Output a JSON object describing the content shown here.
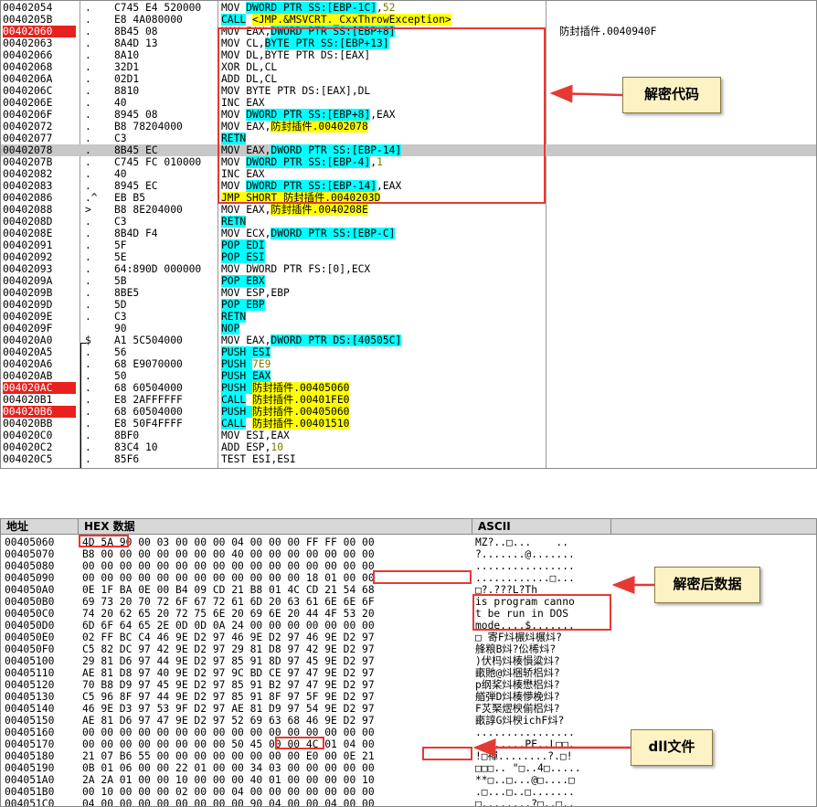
{
  "disasm": {
    "rows": [
      {
        "addr": "00402054",
        "mark": ".",
        "hex": "C745 E4 520000",
        "asm": [
          [
            "MOV ",
            ""
          ],
          [
            "DWORD PTR SS:[EBP-1C]",
            "c"
          ],
          [
            ",",
            ""
          ],
          [
            "52",
            "w"
          ]
        ]
      },
      {
        "addr": "0040205B",
        "mark": ".",
        "hex": "E8 4A080000",
        "asm": [
          [
            "CALL",
            "c"
          ],
          [
            " ",
            ""
          ],
          [
            "<JMP.&MSVCRT._CxxThrowException>",
            "y"
          ]
        ]
      },
      {
        "addr": "00402060",
        "mark": ".",
        "hex": "8B45 08",
        "hl": true,
        "asm": [
          [
            "MOV EAX,",
            ""
          ],
          [
            "DWORD PTR SS:[EBP+8]",
            "c"
          ]
        ],
        "comment": "防封插件.0040940F"
      },
      {
        "addr": "00402063",
        "mark": ".",
        "hex": "8A4D 13",
        "asm": [
          [
            "MOV CL,",
            ""
          ],
          [
            "BYTE PTR SS:[EBP+13]",
            "c"
          ]
        ]
      },
      {
        "addr": "00402066",
        "mark": ".",
        "hex": "8A10",
        "asm": [
          [
            "MOV DL,BYTE PTR DS:[EAX]",
            ""
          ]
        ]
      },
      {
        "addr": "00402068",
        "mark": ".",
        "hex": "32D1",
        "asm": [
          [
            "XOR DL,CL",
            ""
          ]
        ]
      },
      {
        "addr": "0040206A",
        "mark": ".",
        "hex": "02D1",
        "asm": [
          [
            "ADD DL,CL",
            ""
          ]
        ]
      },
      {
        "addr": "0040206C",
        "mark": ".",
        "hex": "8810",
        "asm": [
          [
            "MOV BYTE PTR DS:[EAX],DL",
            ""
          ]
        ]
      },
      {
        "addr": "0040206E",
        "mark": ".",
        "hex": "40",
        "asm": [
          [
            "INC EAX",
            ""
          ]
        ]
      },
      {
        "addr": "0040206F",
        "mark": ".",
        "hex": "8945 08",
        "asm": [
          [
            "MOV ",
            ""
          ],
          [
            "DWORD PTR SS:[EBP+8]",
            "c"
          ],
          [
            ",EAX",
            ""
          ]
        ]
      },
      {
        "addr": "00402072",
        "mark": ".",
        "hex": "B8 78204000",
        "asm": [
          [
            "MOV EAX,",
            ""
          ],
          [
            "防封插件.00402078",
            "y"
          ]
        ]
      },
      {
        "addr": "00402077",
        "mark": ".",
        "hex": "C3",
        "asm": [
          [
            "RETN",
            "c"
          ]
        ]
      },
      {
        "addr": "00402078",
        "mark": ".",
        "hex": "8B45 EC",
        "sel": true,
        "asm": [
          [
            "MOV EAX,",
            ""
          ],
          [
            "DWORD PTR SS:[EBP-14]",
            "c"
          ]
        ]
      },
      {
        "addr": "0040207B",
        "mark": ".",
        "hex": "C745 FC 010000",
        "asm": [
          [
            "MOV ",
            ""
          ],
          [
            "DWORD PTR SS:[EBP-4]",
            "c"
          ],
          [
            ",",
            ""
          ],
          [
            "1",
            "w"
          ]
        ]
      },
      {
        "addr": "00402082",
        "mark": ".",
        "hex": "40",
        "asm": [
          [
            "INC EAX",
            ""
          ]
        ]
      },
      {
        "addr": "00402083",
        "mark": ".",
        "hex": "8945 EC",
        "asm": [
          [
            "MOV ",
            ""
          ],
          [
            "DWORD PTR SS:[EBP-14]",
            "c"
          ],
          [
            ",EAX",
            ""
          ]
        ]
      },
      {
        "addr": "00402086",
        "mark": ".^",
        "hex": "EB B5",
        "asm": [
          [
            "JMP SHORT 防封插件.0040203D",
            "y"
          ]
        ]
      },
      {
        "addr": "00402088",
        "mark": ">",
        "hex": "B8 8E204000",
        "asm": [
          [
            "MOV EAX,",
            ""
          ],
          [
            "防封插件.0040208E",
            "y"
          ]
        ]
      },
      {
        "addr": "0040208D",
        "mark": ".",
        "hex": "C3",
        "asm": [
          [
            "RETN",
            "c"
          ]
        ]
      },
      {
        "addr": "0040208E",
        "mark": ".",
        "hex": "8B4D F4",
        "asm": [
          [
            "MOV ECX,",
            ""
          ],
          [
            "DWORD PTR SS:[EBP-C]",
            "c"
          ]
        ]
      },
      {
        "addr": "00402091",
        "mark": ".",
        "hex": "5F",
        "asm": [
          [
            "POP EDI",
            "c"
          ]
        ]
      },
      {
        "addr": "00402092",
        "mark": ".",
        "hex": "5E",
        "asm": [
          [
            "POP ESI",
            "c"
          ]
        ]
      },
      {
        "addr": "00402093",
        "mark": ".",
        "hex": "64:890D 000000",
        "asm": [
          [
            "MOV DWORD PTR FS:[0],ECX",
            ""
          ]
        ]
      },
      {
        "addr": "0040209A",
        "mark": ".",
        "hex": "5B",
        "asm": [
          [
            "POP EBX",
            "c"
          ]
        ]
      },
      {
        "addr": "0040209B",
        "mark": ".",
        "hex": "8BE5",
        "asm": [
          [
            "MOV ESP,EBP",
            ""
          ]
        ]
      },
      {
        "addr": "0040209D",
        "mark": ".",
        "hex": "5D",
        "asm": [
          [
            "POP EBP",
            "c"
          ]
        ]
      },
      {
        "addr": "0040209E",
        "mark": ".",
        "hex": "C3",
        "asm": [
          [
            "RETN",
            "c"
          ]
        ]
      },
      {
        "addr": "0040209F",
        "mark": "",
        "hex": "90",
        "asm": [
          [
            "NOP",
            "c"
          ]
        ]
      },
      {
        "addr": "004020A0",
        "mark": "$",
        "hex": "A1 5C504000",
        "asm": [
          [
            "MOV EAX,",
            ""
          ],
          [
            "DWORD PTR DS:[40505C]",
            "c"
          ]
        ]
      },
      {
        "addr": "004020A5",
        "mark": ".",
        "hex": "56",
        "asm": [
          [
            "PUSH ESI",
            "c"
          ]
        ]
      },
      {
        "addr": "004020A6",
        "mark": ".",
        "hex": "68 E9070000",
        "asm": [
          [
            "PUSH ",
            "c"
          ],
          [
            "7E9",
            "w"
          ]
        ]
      },
      {
        "addr": "004020AB",
        "mark": ".",
        "hex": "50",
        "asm": [
          [
            "PUSH EAX",
            "c"
          ]
        ]
      },
      {
        "addr": "004020AC",
        "mark": ".",
        "hex": "68 60504000",
        "hl": true,
        "asm": [
          [
            "PUSH ",
            "c"
          ],
          [
            "防封插件.00405060",
            "y"
          ]
        ]
      },
      {
        "addr": "004020B1",
        "mark": ".",
        "hex": "E8 2AFFFFFF",
        "asm": [
          [
            "CALL",
            "c"
          ],
          [
            " ",
            ""
          ],
          [
            "防封插件.00401FE0",
            "y"
          ]
        ]
      },
      {
        "addr": "004020B6",
        "mark": ".",
        "hex": "68 60504000",
        "hl": true,
        "asm": [
          [
            "PUSH ",
            "c"
          ],
          [
            "防封插件.00405060",
            "y"
          ]
        ]
      },
      {
        "addr": "004020BB",
        "mark": ".",
        "hex": "E8 50F4FFFF",
        "asm": [
          [
            "CALL",
            "c"
          ],
          [
            " ",
            ""
          ],
          [
            "防封插件.00401510",
            "y"
          ]
        ]
      },
      {
        "addr": "004020C0",
        "mark": ".",
        "hex": "8BF0",
        "asm": [
          [
            "MOV ESI,EAX",
            ""
          ]
        ]
      },
      {
        "addr": "004020C2",
        "mark": ".",
        "hex": "83C4 10",
        "asm": [
          [
            "ADD ESP,",
            ""
          ],
          [
            "10",
            "w"
          ]
        ]
      },
      {
        "addr": "004020C5",
        "mark": ".",
        "hex": "85F6",
        "asm": [
          [
            "TEST ESI,ESI",
            ""
          ]
        ]
      }
    ]
  },
  "dump": {
    "headers": {
      "addr": "地址",
      "hex": "HEX 数据",
      "ascii": "ASCII"
    },
    "rows": [
      {
        "addr": "00405060",
        "hex": "4D 5A 90 00 03 00 00 00 04 00 00 00 FF FF 00 00",
        "ascii": "MZ?..□...    .."
      },
      {
        "addr": "00405070",
        "hex": "B8 00 00 00 00 00 00 00 40 00 00 00 00 00 00 00",
        "ascii": "?.......@......."
      },
      {
        "addr": "00405080",
        "hex": "00 00 00 00 00 00 00 00 00 00 00 00 00 00 00 00",
        "ascii": "................"
      },
      {
        "addr": "00405090",
        "hex": "00 00 00 00 00 00 00 00 00 00 00 00 18 01 00 00",
        "ascii": "............□..."
      },
      {
        "addr": "004050A0",
        "hex": "0E 1F BA 0E 00 B4 09 CD 21 B8 01 4C CD 21 54 68",
        "ascii": "□?.???L?Th"
      },
      {
        "addr": "004050B0",
        "hex": "69 73 20 70 72 6F 67 72 61 6D 20 63 61 6E 6E 6F",
        "ascii": "is program canno"
      },
      {
        "addr": "004050C0",
        "hex": "74 20 62 65 20 72 75 6E 20 69 6E 20 44 4F 53 20",
        "ascii": "t be run in DOS "
      },
      {
        "addr": "004050D0",
        "hex": "6D 6F 64 65 2E 0D 0D 0A 24 00 00 00 00 00 00 00",
        "ascii": "mode....$......."
      },
      {
        "addr": "004050E0",
        "hex": "02 FF BC C4 46 9E D2 97 46 9E D2 97 46 9E D2 97",
        "ascii": "□ 寄F炓榐炓榐炓?"
      },
      {
        "addr": "004050F0",
        "hex": "C5 82 DC 97 42 9E D2 97 29 81 D8 97 42 9E D2 97",
        "ascii": "艂粮B炓?伀桸炓?"
      },
      {
        "addr": "00405100",
        "hex": "29 81 D6 97 44 9E D2 97 85 91 8D 97 45 9E D2 97",
        "ascii": ")伏杩炓楱愪粱炓?"
      },
      {
        "addr": "00405110",
        "hex": "AE 81 D8 97 40 9E D2 97 9C BD CE 97 47 9E D2 97",
        "ascii": "畞貤@炓梱轿梠炓?"
      },
      {
        "addr": "00405120",
        "hex": "70 B8 D9 97 45 9E D2 97 85 91 B2 97 47 9E D2 97",
        "ascii": "p纲桨炓楱懋梠炓?"
      },
      {
        "addr": "00405130",
        "hex": "C5 96 8F 97 44 9E D2 97 85 91 8F 97 5F 9E D2 97",
        "ascii": "艏弾D炓楱懜梚炓?"
      },
      {
        "addr": "00405140",
        "hex": "46 9E D3 97 53 9F D2 97 AE 81 D9 97 54 9E D2 97",
        "ascii": "F炗棸熤楰偂梠炓?"
      },
      {
        "addr": "00405150",
        "hex": "AE 81 D6 97 47 9E D2 97 52 69 63 68 46 9E D2 97",
        "ascii": "畞諄G炓楰ichF炓?"
      },
      {
        "addr": "00405160",
        "hex": "00 00 00 00 00 00 00 00 00 00 00 00 00 00 00 00",
        "ascii": "................"
      },
      {
        "addr": "00405170",
        "hex": "00 00 00 00 00 00 00 00 50 45 00 00 4C 01 04 00",
        "ascii": "........PE..L□□."
      },
      {
        "addr": "00405180",
        "hex": "21 07 B6 55 00 00 00 00 00 00 00 00 E0 00 0E 21",
        "ascii": "!□禪........?.□!"
      },
      {
        "addr": "00405190",
        "hex": "0B 01 06 00 00 22 01 00 00 34 03 00 00 00 00 00",
        "ascii": "□□□.. \"□..4□....."
      },
      {
        "addr": "004051A0",
        "hex": "2A 2A 01 00 00 10 00 00 00 40 01 00 00 00 00 10",
        "ascii": "**□..□...@□....□"
      },
      {
        "addr": "004051B0",
        "hex": "00 10 00 00 00 02 00 00 04 00 00 00 00 00 00 00",
        "ascii": ".□...□..□......."
      },
      {
        "addr": "004051C0",
        "hex": "04 00 00 00 00 00 00 00 00 90 04 00 00 04 00 00",
        "ascii": "□........?□..□.."
      }
    ]
  },
  "annotations": {
    "decrypt_code": "解密代码",
    "decrypted_data": "解密后数据",
    "dll_file": "dll文件"
  },
  "colors": {
    "highlight_red": "#e8211e",
    "annot_red": "#e53935",
    "asm_yellow": "#ffff00",
    "asm_cyan": "#00ffff"
  }
}
